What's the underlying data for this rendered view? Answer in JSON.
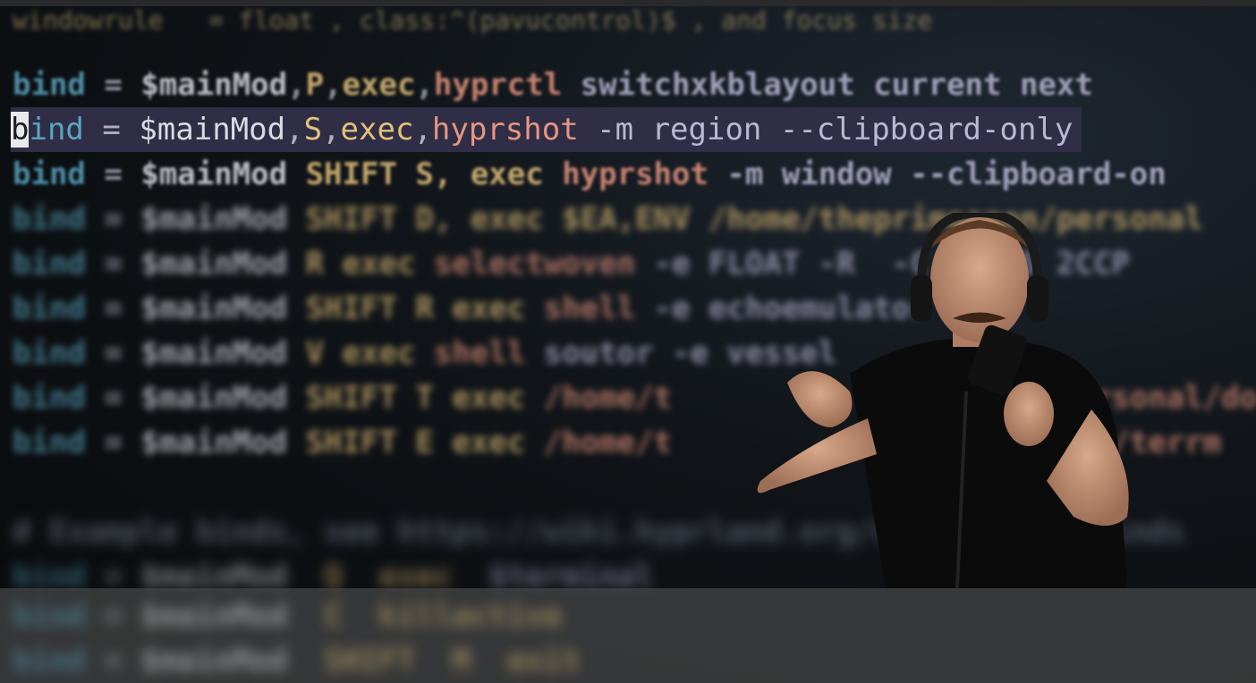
{
  "editor": {
    "top_line": "windowrule   = float , class:^(pavucontrol)$ , and focus size",
    "lines": [
      {
        "kw": "bind",
        "op": " = ",
        "var": "$mainMod",
        "sep1": ",",
        "a1": "P",
        "sep2": ",",
        "a2": "exec",
        "sep3": ",",
        "cmd": "hyprctl",
        "rest": " switchxkblayout current next"
      },
      {
        "cursor": "b",
        "kw": "ind",
        "op": " = ",
        "var": "$mainMod",
        "sep1": ",",
        "a1": "S",
        "sep2": ",",
        "a2": "exec",
        "sep3": ",",
        "cmd": "hyprshot",
        "rest": " -m region --clipboard-only"
      },
      {
        "kw": "bind",
        "op": " = ",
        "var": "$mainMod",
        "sep1": " ",
        "a1": "SHIFT",
        "sep2": " ",
        "a2": "S, exec",
        "sep3": " ",
        "cmd": "hyprshot",
        "rest": " -m window --clipboard-on"
      },
      {
        "kw": "bind",
        "op": " = ",
        "var": "$mainMod",
        "sep1": " ",
        "a1": "SHIFT",
        "sep2": " ",
        "a2": "D, exec",
        "sep3": " ",
        "cmd": "$EA,ENV",
        "rest": " /home/theprimeagen/personal"
      },
      {
        "kw": "bind",
        "op": " = ",
        "var": "$mainMod",
        "sep1": " ",
        "a1": "R",
        "sep2": " ",
        "a2": "exec",
        "sep3": " ",
        "cmd": "selectwoven",
        "rest": " -e FLOAT -R  -C 10 -S 2CCP"
      },
      {
        "kw": "bind",
        "op": " = ",
        "var": "$mainMod",
        "sep1": " ",
        "a1": "SHIFT",
        "sep2": " ",
        "a2": "R exec",
        "sep3": " ",
        "cmd": "shell",
        "rest": " -e echoemulator"
      },
      {
        "kw": "bind",
        "op": " = ",
        "var": "$mainMod",
        "sep1": " ",
        "a1": "V",
        "sep2": " ",
        "a2": "exec",
        "sep3": " ",
        "cmd": "shell",
        "rest": " soutor -e vessel"
      },
      {
        "kw": "bind",
        "op": " = ",
        "var": "$mainMod",
        "sep1": " ",
        "a1": "SHIFT",
        "sep2": " ",
        "a2": "T exec",
        "sep3": " ",
        "cmd": "/home/t",
        "rest": "                     personal/do"
      },
      {
        "kw": "bind",
        "op": " = ",
        "var": "$mainMod",
        "sep1": " ",
        "a1": "SHIFT",
        "sep2": " ",
        "a2": "E exec",
        "sep3": " ",
        "cmd": "/home/t",
        "rest": "                     rch/terrm"
      }
    ],
    "comment": "# Example binds, see https://wiki.hyprland.org/Configuring/Binds",
    "after_comment": [
      {
        "kw": "bind",
        "op": " = ",
        "var": "$mainMod",
        "a1": "Q",
        "a2": "exec",
        "cmd": "$terminal"
      },
      {
        "kw": "bind",
        "op": " = ",
        "var": "$mainMod",
        "a1": "C",
        "a2": "killactive",
        "cmd": ""
      },
      {
        "kw": "bind",
        "op": " = ",
        "var": "$mainMod",
        "a1": "SHIFT",
        "a2": "M",
        "cmd": "exit"
      }
    ]
  },
  "colors": {
    "keyword": "#5aa5c0",
    "arg": "#e3c17a",
    "command": "#e7957f",
    "highlight": "#2f2e46"
  },
  "presenter": {
    "description_icon": "person-with-headphones-and-microphone"
  }
}
